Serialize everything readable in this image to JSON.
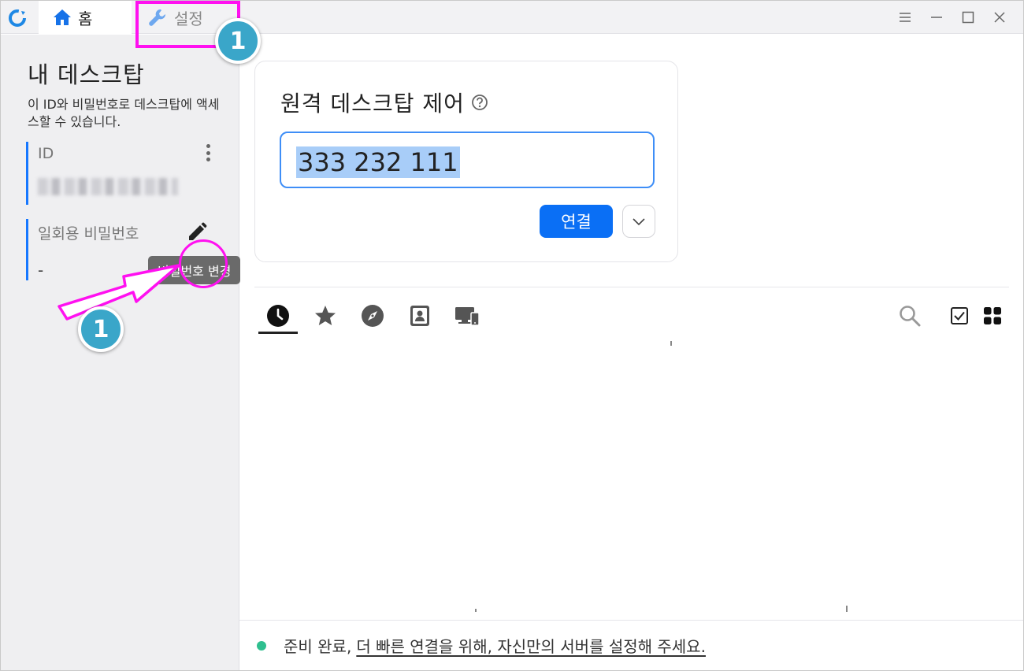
{
  "titlebar": {
    "tabs": [
      {
        "label": "홈",
        "icon": "home-icon"
      },
      {
        "label": "설정",
        "icon": "wrench-icon"
      }
    ],
    "controls": [
      "menu-icon",
      "minimize-icon",
      "maximize-icon",
      "close-icon"
    ]
  },
  "sidebar": {
    "title": "내 데스크탑",
    "description": "이 ID와 비밀번호로 데스크탑에 액세스할 수 있습니다.",
    "id_label": "ID",
    "password_label": "일회용 비밀번호",
    "password_value": "-",
    "edit_tooltip": "비밀번호 변경"
  },
  "remote": {
    "title": "원격 데스크탑 제어",
    "id_value": "333 232 111",
    "connect_label": "연결"
  },
  "peers": {
    "tabs": [
      "recent-icon",
      "favorite-icon",
      "discovered-icon",
      "address-book-icon",
      "group-icon"
    ],
    "active_tab": 0
  },
  "status": {
    "ready": "준비 완료,",
    "link": "더 빠른 연결을 위해, 자신만의 서버를 설정해 주세요."
  },
  "annotations": {
    "badge_1": "1",
    "badge_2": "1"
  },
  "colors": {
    "accent": "#0a6ff5",
    "annotation": "#ff10f0",
    "badge": "#3aa6c9",
    "status_ok": "#2fbf8f"
  }
}
